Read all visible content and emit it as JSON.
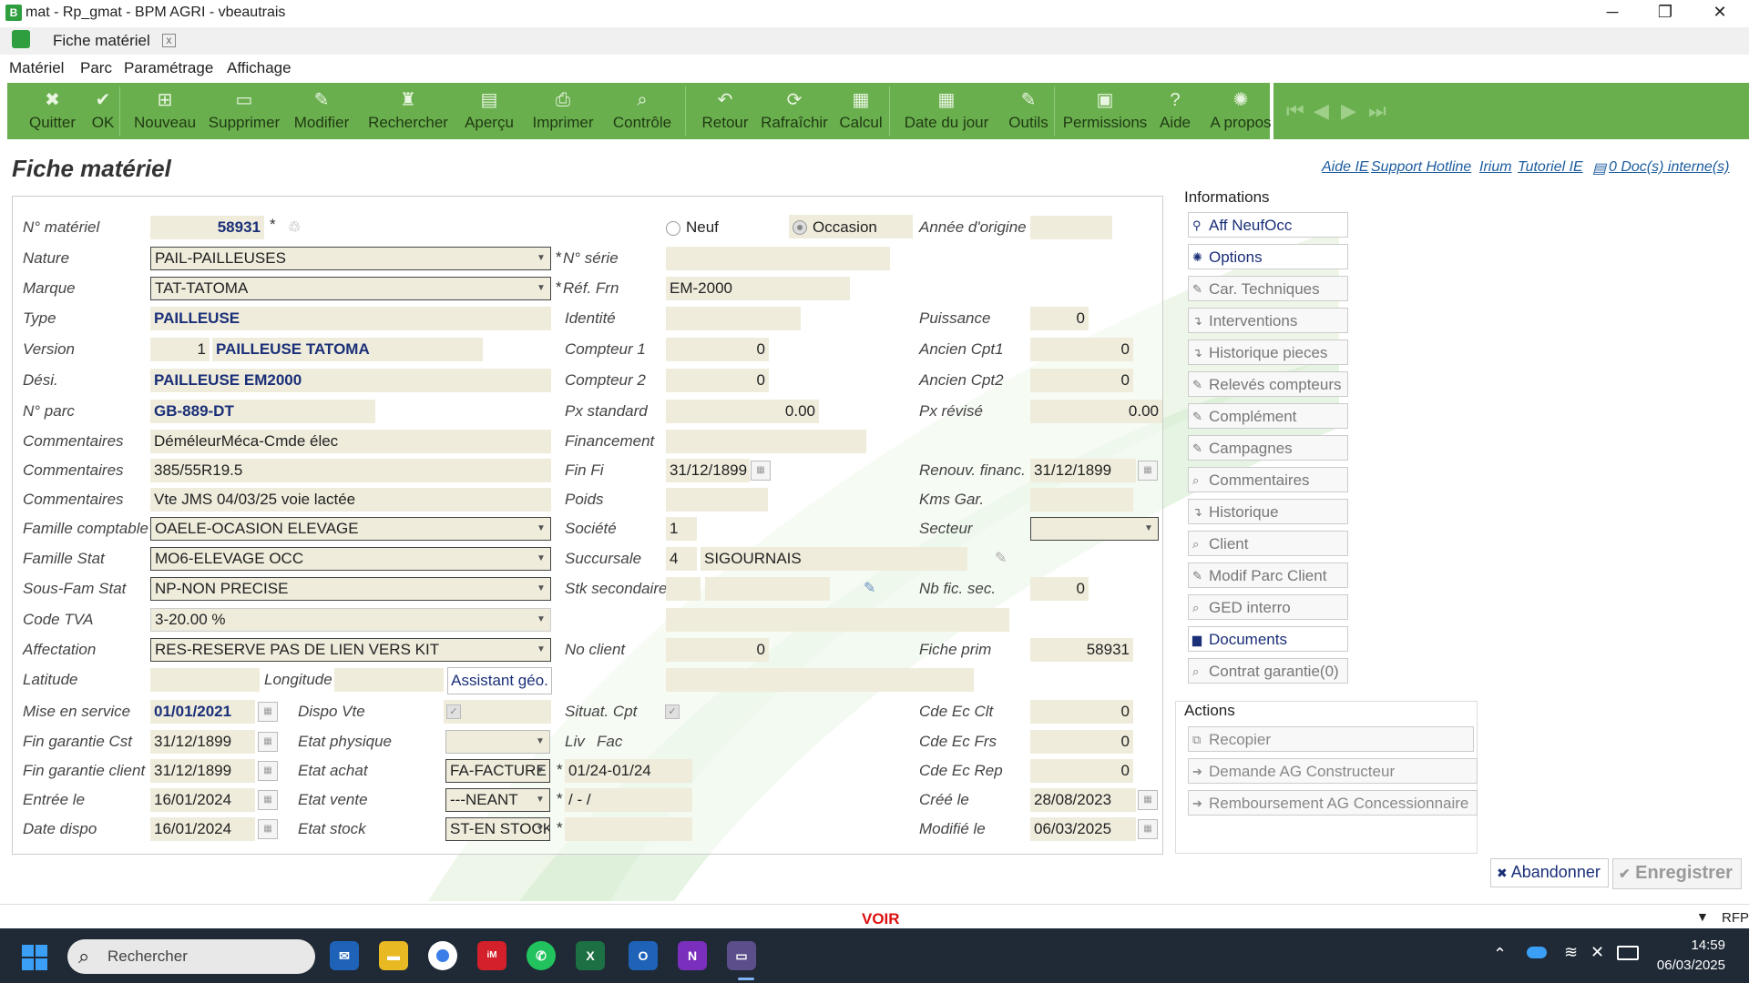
{
  "window": {
    "title": "mat - Rp_gmat - BPM AGRI - vbeautrais",
    "minimize": "─",
    "maximize": "❐",
    "close": "✕"
  },
  "tab": {
    "label": "Fiche matériel",
    "close": "x"
  },
  "menu": [
    "Matériel",
    "Parc",
    "Paramétrage",
    "Affichage"
  ],
  "toolbar": [
    {
      "label": "Quitter",
      "icon": "close-icon",
      "glyph": "✖"
    },
    {
      "label": "OK",
      "icon": "check-icon",
      "glyph": "✔"
    },
    {
      "label": "Nouveau",
      "icon": "new-icon",
      "glyph": "⊞"
    },
    {
      "label": "Supprimer",
      "icon": "delete-icon",
      "glyph": "▭"
    },
    {
      "label": "Modifier",
      "icon": "edit-icon",
      "glyph": "✎"
    },
    {
      "label": "Rechercher",
      "icon": "binoculars-icon",
      "glyph": "♜"
    },
    {
      "label": "Aperçu",
      "icon": "preview-icon",
      "glyph": "▤"
    },
    {
      "label": "Imprimer",
      "icon": "printer-icon",
      "glyph": "⎙"
    },
    {
      "label": "Contrôle",
      "icon": "magnifier-icon",
      "glyph": "⌕"
    },
    {
      "label": "Retour",
      "icon": "undo-icon",
      "glyph": "↶"
    },
    {
      "label": "Rafraîchir",
      "icon": "refresh-icon",
      "glyph": "⟳"
    },
    {
      "label": "Calcul",
      "icon": "calculator-icon",
      "glyph": "▦"
    },
    {
      "label": "Date du jour",
      "icon": "calendar-icon",
      "glyph": "▦"
    },
    {
      "label": "Outils",
      "icon": "wrench-icon",
      "glyph": "✎"
    },
    {
      "label": "Permissions",
      "icon": "lock-icon",
      "glyph": "▣"
    },
    {
      "label": "Aide",
      "icon": "help-icon",
      "glyph": "?"
    },
    {
      "label": "A propos",
      "icon": "gear-icon",
      "glyph": "✺"
    }
  ],
  "nav": {
    "first": "⏮",
    "prev": "◀",
    "next": "▶",
    "last": "⏭"
  },
  "page": {
    "title": "Fiche matériel",
    "links": [
      "Aide IE",
      "Support Hotline",
      "Irium",
      "Tutoriel IE"
    ],
    "docs_link": "0 Doc(s) interne(s)",
    "status_text": "VOIR",
    "status_right": "RFP"
  },
  "form": {
    "labels": {
      "no_materiel": "N° matériel",
      "nature": "Nature",
      "marque": "Marque",
      "type": "Type",
      "version": "Version",
      "desi": "Dési.",
      "no_parc": "N° parc",
      "commentaires1": "Commentaires",
      "commentaires2": "Commentaires",
      "commentaires3": "Commentaires",
      "famille_comptable": "Famille comptable",
      "famille_stat": "Famille Stat",
      "sous_fam_stat": "Sous-Fam Stat",
      "code_tva": "Code TVA",
      "affectation": "Affectation",
      "latitude": "Latitude",
      "longitude": "Longitude",
      "mise_en_service": "Mise en service",
      "fin_garantie_cst": "Fin garantie Cst",
      "fin_garantie_client": "Fin garantie client",
      "entree_le": "Entrée le",
      "date_dispo": "Date dispo",
      "no_serie": "N° série",
      "ref_frn": "Réf. Frn",
      "identite": "Identité",
      "compteur1": "Compteur 1",
      "compteur2": "Compteur 2",
      "px_standard": "Px standard",
      "financement": "Financement",
      "fin_fi": "Fin Fi",
      "poids": "Poids",
      "societe": "Société",
      "succursale": "Succursale",
      "stk_secondaire": "Stk secondaire",
      "no_client": "No client",
      "dispo_vte": "Dispo Vte",
      "etat_physique": "Etat physique",
      "etat_achat": "Etat achat",
      "etat_vente": "Etat vente",
      "etat_stock": "Etat stock",
      "situat_cpt": "Situat. Cpt",
      "liv": "Liv",
      "fac": "Fac",
      "neuf": "Neuf",
      "occasion": "Occasion",
      "annee_origine": "Année d'origine",
      "puissance": "Puissance",
      "ancien_cpt1": "Ancien Cpt1",
      "ancien_cpt2": "Ancien Cpt2",
      "px_revise": "Px révisé",
      "renouv_financ": "Renouv. financ.",
      "kms_gar": "Kms Gar.",
      "secteur": "Secteur",
      "nb_fic_sec": "Nb fic. sec.",
      "fiche_prim": "Fiche prim",
      "cde_ec_clt": "Cde Ec Clt",
      "cde_ec_frs": "Cde Ec Frs",
      "cde_ec_rep": "Cde Ec Rep",
      "cree_le": "Créé le",
      "modifie_le": "Modifié le"
    },
    "values": {
      "no_materiel": "58931",
      "nature": "PAIL-PAILLEUSES",
      "marque": "TAT-TATOMA",
      "type": "PAILLEUSE",
      "version_num": "1",
      "version_text": "PAILLEUSE TATOMA",
      "desi": "PAILLEUSE EM2000",
      "no_parc": "GB-889-DT",
      "commentaires1": "DéméleurMéca-Cmde élec",
      "commentaires2": "385/55R19.5",
      "commentaires3": "Vte JMS  04/03/25 voie lactée",
      "famille_comptable": "OAELE-OCASION ELEVAGE",
      "famille_stat": "MO6-ELEVAGE OCC",
      "sous_fam_stat": "NP-NON PRECISE",
      "code_tva": "3-20.00 %",
      "affectation": "RES-RESERVE PAS DE LIEN VERS KIT",
      "assistant_geo": "Assistant géo.",
      "mise_en_service": "01/01/2021",
      "fin_garantie_cst": "31/12/1899",
      "fin_garantie_client": "31/12/1899",
      "entree_le": "16/01/2024",
      "date_dispo": "16/01/2024",
      "ref_frn": "EM-2000",
      "compteur1": "0",
      "compteur2": "0",
      "px_standard": "0.00",
      "fin_fi": "31/12/1899",
      "societe": "1",
      "succursale_code": "4",
      "succursale_name": "SIGOURNAIS",
      "no_client": "0",
      "etat_achat": "FA-FACTURE",
      "etat_vente": "---NEANT",
      "etat_stock": "ST-EN STOCK",
      "liv_fac": "01/24-01/24",
      "etat_vente_date": " /  -  /",
      "puissance": "0",
      "ancien_cpt1": "0",
      "ancien_cpt2": "0",
      "px_revise": "0.00",
      "renouv_financ": "31/12/1899",
      "nb_fic_sec": "0",
      "fiche_prim": "58931",
      "cde_ec_clt": "0",
      "cde_ec_frs": "0",
      "cde_ec_rep": "0",
      "cree_le": "28/08/2023",
      "modifie_le": "06/03/2025",
      "star": "*"
    }
  },
  "informations": {
    "title": "Informations",
    "buttons": [
      {
        "label": "Aff NeufOcc",
        "icon": "link-icon",
        "glyph": "⚲",
        "active": true
      },
      {
        "label": "Options",
        "icon": "gear-icon",
        "glyph": "✺",
        "active": true
      },
      {
        "label": "Car. Techniques",
        "icon": "edit-icon",
        "glyph": "✎",
        "active": false
      },
      {
        "label": "Interventions",
        "icon": "arrow-icon",
        "glyph": "↴",
        "active": false
      },
      {
        "label": "Historique pieces",
        "icon": "arrow-icon",
        "glyph": "↴",
        "active": false
      },
      {
        "label": "Relevés compteurs",
        "icon": "edit-icon",
        "glyph": "✎",
        "active": false
      },
      {
        "label": "Complément",
        "icon": "edit-icon",
        "glyph": "✎",
        "active": false
      },
      {
        "label": "Campagnes",
        "icon": "edit-icon",
        "glyph": "✎",
        "active": false
      },
      {
        "label": "Commentaires",
        "icon": "search-icon",
        "glyph": "⌕",
        "active": false
      },
      {
        "label": "Historique",
        "icon": "arrow-icon",
        "glyph": "↴",
        "active": false
      },
      {
        "label": "Client",
        "icon": "search-icon",
        "glyph": "⌕",
        "active": false
      },
      {
        "label": "Modif Parc Client",
        "icon": "edit-icon",
        "glyph": "✎",
        "active": false
      },
      {
        "label": "GED interro",
        "icon": "search-icon",
        "glyph": "⌕",
        "active": false
      },
      {
        "label": "Documents",
        "icon": "document-icon",
        "glyph": "▆",
        "active": true
      },
      {
        "label": "Contrat garantie(0)",
        "icon": "search-icon",
        "glyph": "⌕",
        "active": false
      }
    ]
  },
  "actions": {
    "title": "Actions",
    "buttons": [
      {
        "label": "Recopier",
        "icon": "copy-icon",
        "glyph": "⧉"
      },
      {
        "label": "Demande AG Constructeur",
        "icon": "arrow-right-icon",
        "glyph": "➔"
      },
      {
        "label": "Remboursement AG Concessionnaire",
        "icon": "arrow-right-icon",
        "glyph": "➔"
      }
    ]
  },
  "footer": {
    "abandon": "Abandonner",
    "save": "Enregistrer"
  },
  "taskbar": {
    "search_placeholder": "Rechercher",
    "time": "14:59",
    "date": "06/03/2025"
  }
}
